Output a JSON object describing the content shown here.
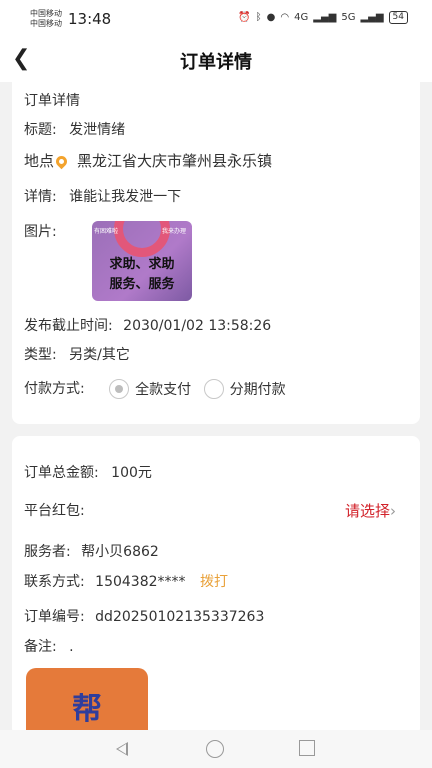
{
  "status": {
    "carrier1": "中国移动",
    "carrier2": "中国移动",
    "time": "13:48",
    "net1": "4G",
    "net2": "5G",
    "battery": "54"
  },
  "nav": {
    "title": "订单详情"
  },
  "order": {
    "section_title": "订单详情",
    "title_label": "标题:",
    "title_value": "发泄情绪",
    "location_label": "地点",
    "location_value": "黑龙江省大庆市肇州县永乐镇",
    "detail_label": "详情:",
    "detail_value": "谁能让我发泄一下",
    "image_label": "图片:",
    "image": {
      "tl": "有困难啦",
      "tr": "我来办理",
      "line1": "求助、求助",
      "line2": "服务、服务"
    },
    "deadline_label": "发布截止时间:",
    "deadline_value": "2030/01/02 13:58:26",
    "type_label": "类型:",
    "type_value": "另类/其它",
    "pay_label": "付款方式:",
    "pay_options": [
      "全款支付",
      "分期付款"
    ],
    "pay_selected": "全款支付"
  },
  "summary": {
    "total_label": "订单总金额:",
    "total_value": "100元",
    "coupon_label": "平台红包:",
    "coupon_choose": "请选择",
    "provider_label": "服务者:",
    "provider_value": "帮小贝6862",
    "contact_label": "联系方式:",
    "contact_value": "1504382****",
    "call_label": "拨打",
    "order_no_label": "订单编号:",
    "order_no_value": "dd20250102135337263",
    "remark_label": "备注:",
    "remark_value": ".",
    "logo_text": "帮"
  }
}
